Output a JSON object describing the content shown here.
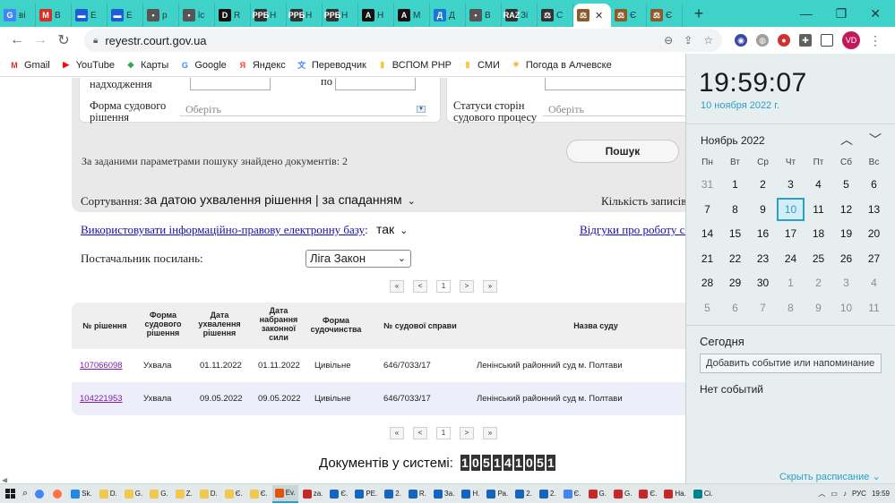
{
  "browser": {
    "tabs": [
      {
        "label": "ві",
        "icon": "G",
        "color": "#4285f4"
      },
      {
        "label": "В",
        "icon": "M",
        "color": "#d93025"
      },
      {
        "label": "Е",
        "icon": "▬",
        "color": "#1e5bd6"
      },
      {
        "label": "Е",
        "icon": "▬",
        "color": "#1e5bd6"
      },
      {
        "label": "р",
        "icon": "▪",
        "color": "#555555"
      },
      {
        "label": "lc",
        "icon": "▪",
        "color": "#555555"
      },
      {
        "label": "R",
        "icon": "D",
        "color": "#111111"
      },
      {
        "label": "Н",
        "icon": "РРБ",
        "color": "#333333"
      },
      {
        "label": "Н",
        "icon": "РРБ",
        "color": "#333333"
      },
      {
        "label": "Н",
        "icon": "РРБ",
        "color": "#333333"
      },
      {
        "label": "Н",
        "icon": "А",
        "color": "#111111"
      },
      {
        "label": "М",
        "icon": "А",
        "color": "#111111"
      },
      {
        "label": "Д",
        "icon": "Д",
        "color": "#1976d2"
      },
      {
        "label": "В",
        "icon": "▪",
        "color": "#555555"
      },
      {
        "label": "Зі",
        "icon": "RAZ",
        "color": "#333333"
      },
      {
        "label": "С",
        "icon": "⚖",
        "color": "#333333"
      },
      {
        "label": "",
        "icon": "⚖",
        "color": "#8d5a2b",
        "active": true
      },
      {
        "label": "Є",
        "icon": "⚖",
        "color": "#8d5a2b"
      },
      {
        "label": "Є",
        "icon": "⚖",
        "color": "#8d5a2b"
      }
    ],
    "new_tab": "+",
    "url": "reyestr.court.gov.ua",
    "profile": "VD",
    "bookmarks": [
      {
        "label": "Gmail",
        "icon": "M",
        "color": "#d93025"
      },
      {
        "label": "YouTube",
        "icon": "▶",
        "color": "#ff0000"
      },
      {
        "label": "Карты",
        "icon": "◆",
        "color": "#34a853"
      },
      {
        "label": "Google",
        "icon": "G",
        "color": "#4285f4"
      },
      {
        "label": "Яндекс",
        "icon": "Я",
        "color": "#fc3f1d"
      },
      {
        "label": "Переводчик",
        "icon": "文",
        "color": "#4285f4"
      },
      {
        "label": "ВСПОМ РНР",
        "icon": "▮",
        "color": "#f2c94c"
      },
      {
        "label": "СМИ",
        "icon": "▮",
        "color": "#f2c94c"
      },
      {
        "label": "Погода в Алчевске",
        "icon": "☀",
        "color": "#f9a825"
      }
    ]
  },
  "filters": {
    "receipt_label": "надходження",
    "to_label": "по",
    "decision_form_label": "Форма судового рішення",
    "decision_form_placeholder": "Оберіть",
    "party_status_label": "Статуси сторін судового процесу",
    "party_status_placeholder": "Оберіть",
    "found_text": "За заданими параметрами пошуку знайдено документів: 2",
    "search_button": "Пошук"
  },
  "options": {
    "sort_label": "Сортування:",
    "sort_value": "за датою ухвалення рішення | за спаданням",
    "records_label": "Кількість записів",
    "use_db_link": "Використовувати інформаційно-правову електронну базу",
    "use_db_value": "так",
    "feedback_link": "Відгуки про роботу са",
    "provider_label": "Постачальник посилань:",
    "provider_value": "Ліга Закон"
  },
  "pager": {
    "first": "«",
    "prev": "<",
    "page": "1",
    "next": ">",
    "last": "»"
  },
  "table": {
    "headers": [
      "№ рішення",
      "Форма судового рішення",
      "Дата ухвалення рішення",
      "Дата набрання законної сили",
      "Форма судочинства",
      "№ судової справи",
      "Назва суду"
    ],
    "rows": [
      [
        "107066098",
        "Ухвала",
        "01.11.2022",
        "01.11.2022",
        "Цивільне",
        "646/7033/17",
        "Ленінський районний суд м. Полтави"
      ],
      [
        "104221953",
        "Ухвала",
        "09.05.2022",
        "09.05.2022",
        "Цивільне",
        "646/7033/17",
        "Ленінський районний суд м. Полтави"
      ]
    ]
  },
  "docs_in_system": {
    "label": "Документів у системі:",
    "digits": [
      "1",
      "0",
      "5",
      "1",
      "4",
      "1",
      "0",
      "5",
      "1"
    ]
  },
  "calendar": {
    "time": "19:59:07",
    "date_link": "10 ноября 2022 г.",
    "month": "Ноябрь 2022",
    "weekdays": [
      "Пн",
      "Вт",
      "Ср",
      "Чт",
      "Пт",
      "Сб",
      "Вс"
    ],
    "weeks": [
      [
        "31",
        "1",
        "2",
        "3",
        "4",
        "5",
        "6"
      ],
      [
        "7",
        "8",
        "9",
        "10",
        "11",
        "12",
        "13"
      ],
      [
        "14",
        "15",
        "16",
        "17",
        "18",
        "19",
        "20"
      ],
      [
        "21",
        "22",
        "23",
        "24",
        "25",
        "26",
        "27"
      ],
      [
        "28",
        "29",
        "30",
        "1",
        "2",
        "3",
        "4"
      ],
      [
        "5",
        "6",
        "7",
        "8",
        "9",
        "10",
        "11"
      ]
    ],
    "today_label": "Сегодня",
    "add_event": "Добавить событие или напоминание",
    "no_events": "Нет событий",
    "hide_schedule": "Скрыть расписание"
  },
  "taskbar": {
    "items": [
      {
        "label": "Sk.",
        "color": "#1e88e5"
      },
      {
        "label": "D.",
        "color": "#f2c94c"
      },
      {
        "label": "G.",
        "color": "#f2c94c"
      },
      {
        "label": "G.",
        "color": "#f2c94c"
      },
      {
        "label": "Z.",
        "color": "#f2c94c"
      },
      {
        "label": "D.",
        "color": "#f2c94c"
      },
      {
        "label": "Є.",
        "color": "#f2c94c"
      },
      {
        "label": "Є.",
        "color": "#f2c94c"
      },
      {
        "label": "Ev.",
        "color": "#e65100",
        "active": true
      },
      {
        "label": "za.",
        "color": "#c62828"
      },
      {
        "label": "Є.",
        "color": "#1565c0"
      },
      {
        "label": "РЕ.",
        "color": "#1565c0"
      },
      {
        "label": "2.",
        "color": "#1565c0"
      },
      {
        "label": "R.",
        "color": "#1565c0"
      },
      {
        "label": "За.",
        "color": "#1565c0"
      },
      {
        "label": "Н.",
        "color": "#1565c0"
      },
      {
        "label": "Ра.",
        "color": "#1565c0"
      },
      {
        "label": "2.",
        "color": "#1565c0"
      },
      {
        "label": "2.",
        "color": "#1565c0"
      },
      {
        "label": "Є.",
        "color": "#4285f4"
      },
      {
        "label": "G.",
        "color": "#c62828"
      },
      {
        "label": "G.",
        "color": "#c62828"
      },
      {
        "label": "Є.",
        "color": "#c62828"
      },
      {
        "label": "На.",
        "color": "#c62828"
      },
      {
        "label": "Сі.",
        "color": "#00838f"
      }
    ],
    "lang": "РУС",
    "time": "19:59"
  }
}
